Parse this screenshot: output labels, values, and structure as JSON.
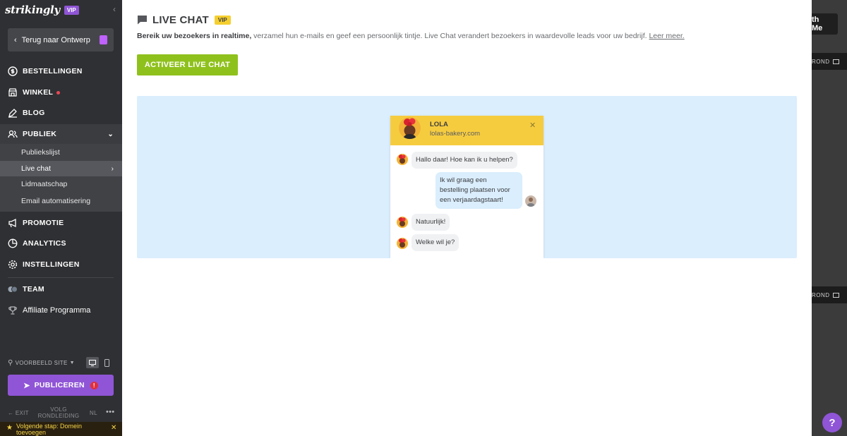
{
  "sidebar": {
    "logo": "strikingly",
    "vip": "VIP",
    "back_button": "Terug naar Ontwerp",
    "nav": {
      "bestellingen": "BESTELLINGEN",
      "winkel": "WINKEL",
      "blog": "BLOG",
      "publiek": "PUBLIEK",
      "promotie": "PROMOTIE",
      "analytics": "ANALYTICS",
      "instellingen": "INSTELLINGEN",
      "team": "TEAM",
      "affiliate": "Affiliate Programma"
    },
    "sub_items": [
      "Publiekslijst",
      "Live chat",
      "Lidmaatschap",
      "Email automatisering"
    ],
    "preview_label": "VOORBEELD SITE",
    "publish_button": "PUBLICEREN",
    "publish_alert": "!",
    "footer": {
      "exit": "EXIT",
      "tour_line1": "VOLG",
      "tour_line2": "RONDLEIDING",
      "lang": "NL",
      "more": "•••"
    },
    "next_step_line1": "Volgende stap: Domein",
    "next_step_line2": "toevoegen"
  },
  "main": {
    "title": "LIVE CHAT",
    "vip": "VIP",
    "desc_bold": "Bereik uw bezoekers in realtime,",
    "desc_rest": " verzamel hun e-mails en geef een persoonlijk tintje. Live Chat verandert bezoekers in waardevolle leads voor uw bedrijf. ",
    "desc_link": "Leer meer.",
    "activate_button": "ACTIVEER LIVE CHAT",
    "chat": {
      "name": "LOLA",
      "site": "lolas-bakery.com",
      "messages": [
        "Hallo daar! Hoe kan ik u helpen?",
        "Ik wil graag een",
        "bestelling plaatsen voor",
        "een verjaardagstaart!",
        "Natuurlijk!",
        "Welke wil je?"
      ]
    }
  },
  "right_edge": {
    "button": "th Me",
    "tag": "ROND"
  },
  "help": "?",
  "colors": {
    "sidebar": "#2f3033",
    "accent_purple": "#8f55d6",
    "activate_green": "#8fc11d",
    "chat_yellow": "#f6cc3f",
    "preview_blue": "#daeefd"
  }
}
